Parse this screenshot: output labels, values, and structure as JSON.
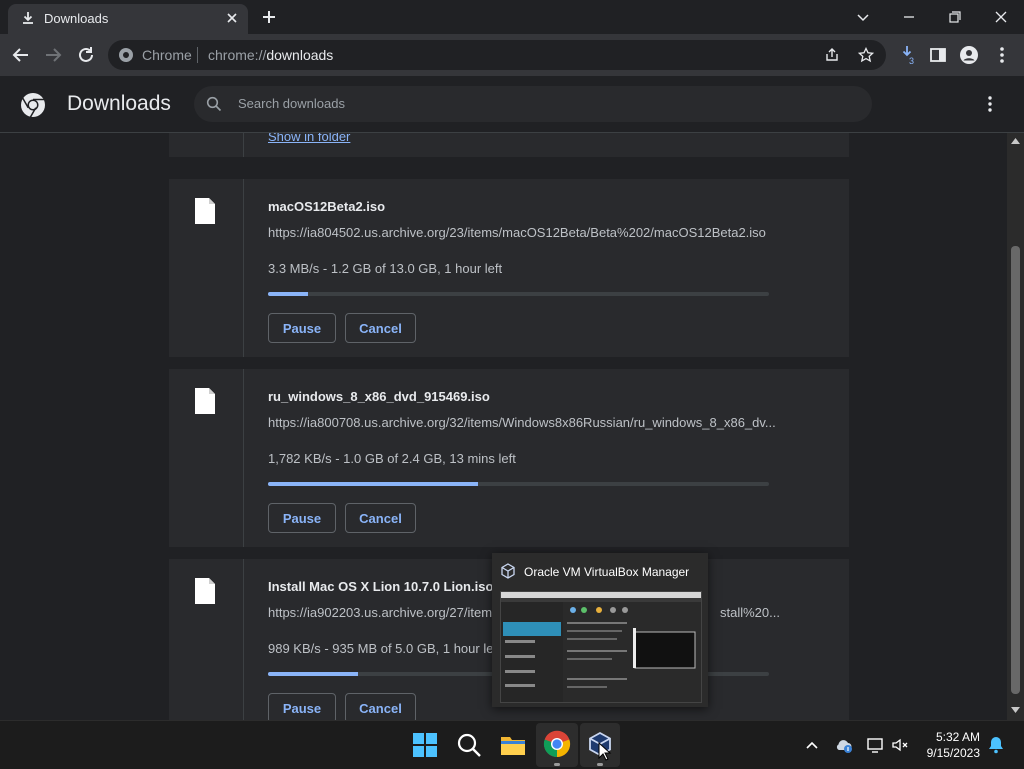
{
  "browser": {
    "tab_title": "Downloads",
    "omnibox": {
      "chip": "Chrome",
      "url_scheme": "chrome://",
      "url_host": "downloads"
    },
    "extension_badge": "3"
  },
  "page": {
    "title": "Downloads",
    "search_placeholder": "Search downloads"
  },
  "downloads": {
    "show_in_folder_label": "Show in folder",
    "items": [
      {
        "name": "macOS12Beta2.iso",
        "url": "https://ia804502.us.archive.org/23/items/macOS12Beta/Beta%202/macOS12Beta2.iso",
        "status": "3.3 MB/s - 1.2 GB of 13.0 GB, 1 hour left",
        "progress": 0.08,
        "pause_label": "Pause",
        "cancel_label": "Cancel"
      },
      {
        "name": "ru_windows_8_x86_dvd_915469.iso",
        "url": "https://ia800708.us.archive.org/32/items/Windows8x86Russian/ru_windows_8_x86_dv...",
        "status": "1,782 KB/s - 1.0 GB of 2.4 GB, 13 mins left",
        "progress": 0.42,
        "pause_label": "Pause",
        "cancel_label": "Cancel"
      },
      {
        "name": "Install Mac OS X Lion 10.7.0 Lion.iso",
        "url": "https://ia902203.us.archive.org/27/items/",
        "url_tail": "stall%20...",
        "status": "989 KB/s - 935 MB of 5.0 GB, 1 hour le",
        "progress": 0.18,
        "pause_label": "Pause",
        "cancel_label": "Cancel"
      }
    ]
  },
  "taskbar_preview": {
    "title": "Oracle VM VirtualBox Manager"
  },
  "taskbar": {
    "time": "5:32 AM",
    "date": "9/15/2023"
  },
  "colors": {
    "accent": "#8ab4f8",
    "background": "#202124",
    "card": "#292a2d"
  }
}
